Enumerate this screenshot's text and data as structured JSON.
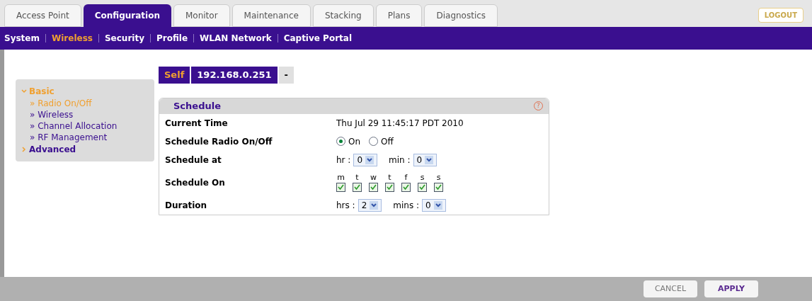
{
  "tabs": [
    {
      "label": "Access Point",
      "selected": false
    },
    {
      "label": "Configuration",
      "selected": true
    },
    {
      "label": "Monitor",
      "selected": false
    },
    {
      "label": "Maintenance",
      "selected": false
    },
    {
      "label": "Stacking",
      "selected": false
    },
    {
      "label": "Plans",
      "selected": false
    },
    {
      "label": "Diagnostics",
      "selected": false
    }
  ],
  "logout": "LOGOUT",
  "subtabs": [
    {
      "label": "System",
      "selected": false
    },
    {
      "label": "Wireless",
      "selected": true
    },
    {
      "label": "Security",
      "selected": false
    },
    {
      "label": "Profile",
      "selected": false
    },
    {
      "label": "WLAN Network",
      "selected": false
    },
    {
      "label": "Captive Portal",
      "selected": false
    }
  ],
  "sidebar": {
    "items": [
      {
        "label": "Basic",
        "expanded": true,
        "children": [
          {
            "label": "» Radio On/Off",
            "selected": true
          },
          {
            "label": "» Wireless",
            "selected": false
          },
          {
            "label": "» Channel Allocation",
            "selected": false
          },
          {
            "label": "» RF Management",
            "selected": false
          }
        ]
      },
      {
        "label": "Advanced",
        "expanded": false
      }
    ]
  },
  "device": {
    "self": "Self",
    "ip": "192.168.0.251",
    "dropdown": "-"
  },
  "schedule": {
    "title": "Schedule",
    "help": "?",
    "rows": [
      {
        "kind": "text",
        "label": "Current Time",
        "value": "Thu Jul 29 11:45:17 PDT 2010"
      },
      {
        "kind": "radio",
        "label": "Schedule Radio On/Off",
        "options": [
          {
            "label": "On",
            "selected": true
          },
          {
            "label": "Off",
            "selected": false
          }
        ]
      },
      {
        "kind": "selects",
        "label": "Schedule at",
        "selects": [
          {
            "label": "hr :",
            "value": "0"
          },
          {
            "label": "min :",
            "value": "0"
          }
        ]
      },
      {
        "kind": "days",
        "label": "Schedule On",
        "days": [
          {
            "label": "m",
            "checked": true
          },
          {
            "label": "t",
            "checked": true
          },
          {
            "label": "w",
            "checked": true
          },
          {
            "label": "t",
            "checked": true
          },
          {
            "label": "f",
            "checked": true
          },
          {
            "label": "s",
            "checked": true
          },
          {
            "label": "s",
            "checked": true
          }
        ]
      },
      {
        "kind": "selects",
        "label": "Duration",
        "selects": [
          {
            "label": "hrs :",
            "value": "2"
          },
          {
            "label": "mins :",
            "value": "0"
          }
        ]
      }
    ]
  },
  "buttons": [
    {
      "label": "CANCEL",
      "kind": "cancel"
    },
    {
      "label": "APPLY",
      "kind": "apply"
    }
  ]
}
